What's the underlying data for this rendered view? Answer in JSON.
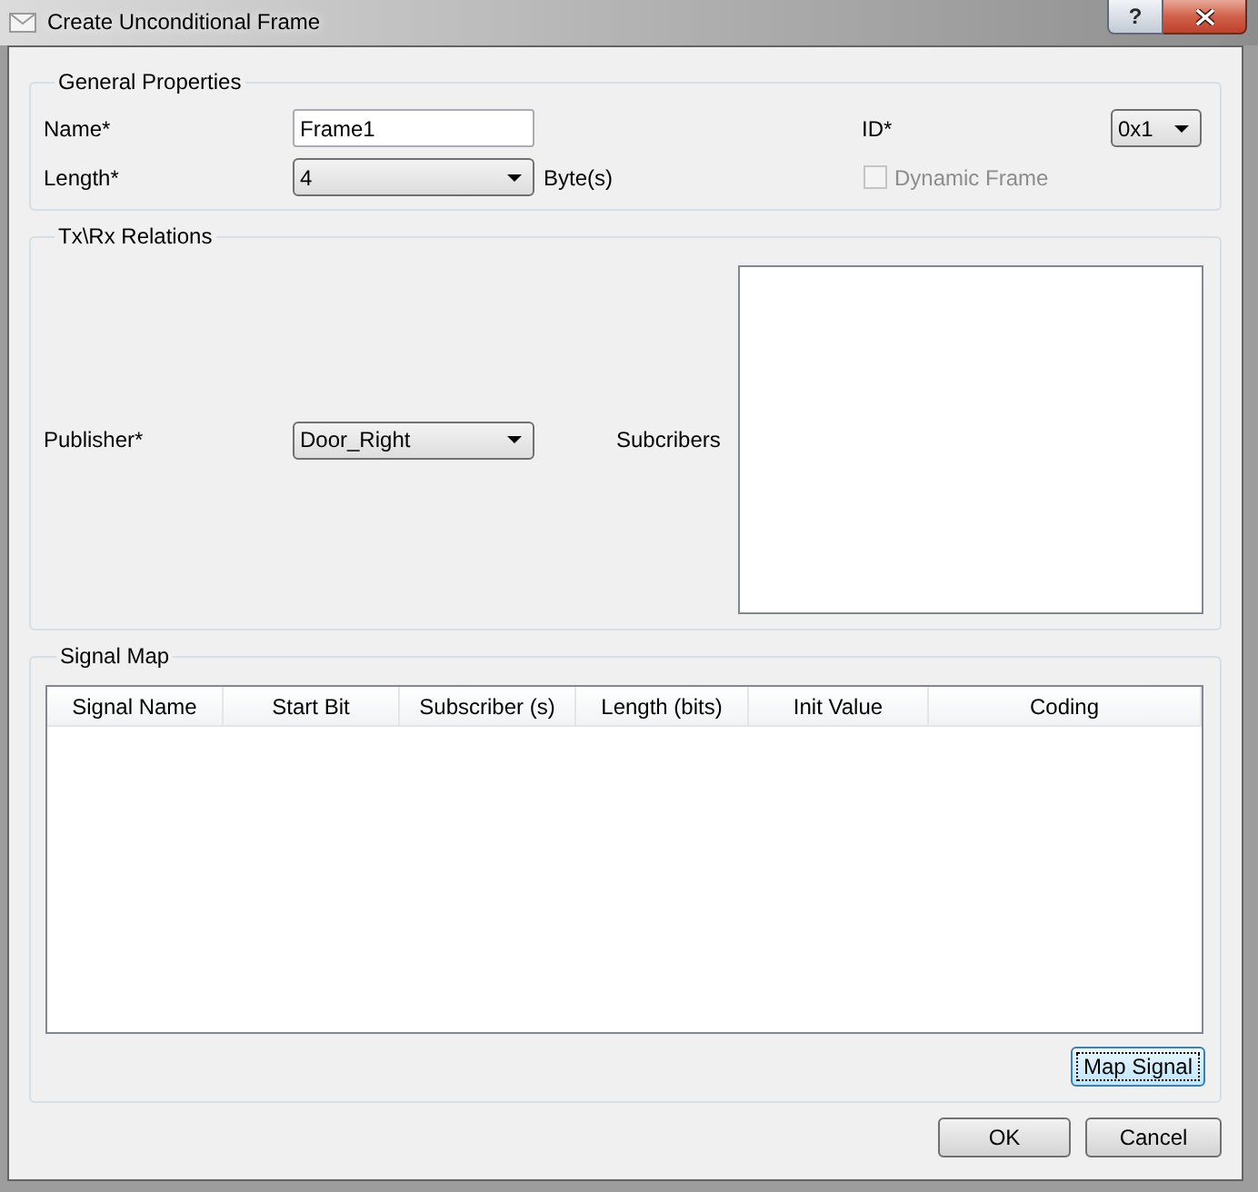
{
  "window": {
    "title": "Create Unconditional Frame",
    "help_button": "?"
  },
  "general_properties": {
    "title": "General Properties",
    "name": {
      "label": "Name*",
      "value": "Frame1"
    },
    "length": {
      "label": "Length*",
      "value": "4",
      "unit": "Byte(s)"
    },
    "id": {
      "label": "ID*",
      "value": "0x1"
    },
    "dynamic_frame": {
      "label": "Dynamic Frame",
      "checked": false,
      "disabled": true
    }
  },
  "tx_rx_relations": {
    "title": "Tx\\Rx Relations",
    "publisher": {
      "label": "Publisher*",
      "value": "Door_Right"
    },
    "subscribers": {
      "label": "Subcribers"
    }
  },
  "signal_map": {
    "title": "Signal Map",
    "table": {
      "columns": [
        "Signal Name",
        "Start Bit",
        "Subscriber (s)",
        "Length (bits)",
        "Init Value",
        "Coding"
      ]
    },
    "map_button": {
      "label": "Map Signal",
      "focused": true
    }
  },
  "buttons": [
    {
      "label": "OK"
    },
    {
      "label": "Cancel"
    }
  ]
}
